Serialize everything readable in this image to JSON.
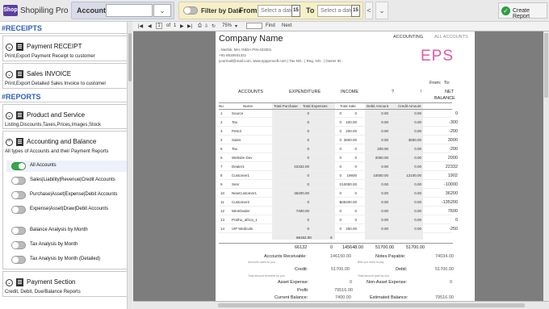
{
  "app": {
    "logo_text": "Shop",
    "title": "Shopiling Pro"
  },
  "topbar": {
    "accounts_label": "Accounts",
    "accounts_value": "",
    "dropdown_glyph": "⌄",
    "filter_label": "Filter by Date",
    "from_label": "From",
    "to_label": "To",
    "date_placeholder": "Select a date",
    "cal_num": "15",
    "create_label": "Create Report",
    "more_glyph": "⌄",
    "nav_glyph": "<"
  },
  "sidebar": {
    "receipts_header": "#RECEIPTS",
    "reports_header": "#REPORTS",
    "payment_receipt": {
      "title": "Payment RECEIPT",
      "desc": "Print,Export Payment Receipt to customer"
    },
    "sales_invoice": {
      "title": "Sales INVOICE",
      "desc": "Print,Export Detailed Sales Invoice to customer"
    },
    "product_service": {
      "title": "Product and Service",
      "desc": "Listing,Discounts,Taxes,Prices,Images,Stock"
    },
    "accounting_balance": {
      "title": "Accounting and Balance",
      "desc": "All types of Accounts and their Payment Reports"
    },
    "options": [
      {
        "label": "All Accounts",
        "on": true
      },
      {
        "label": "Sales|Liability|Revenue|Credit Accounts",
        "on": false
      },
      {
        "label": "Purchase|Asset|Expense|Debit Accounts",
        "on": false
      },
      {
        "label": "Expense|Asset|Draw|Debit Accounts",
        "on": false
      },
      {
        "label": "Balance Analysis by Month",
        "on": false
      },
      {
        "label": "Tax Analysis by Month",
        "on": false
      },
      {
        "label": "Tax Analysis by Month (Detailed)",
        "on": false
      }
    ],
    "payment_section": {
      "title": "Payment Section",
      "desc": "Credit, Debit, Due/Balance Reports"
    }
  },
  "viewer": {
    "page": "1",
    "of": "of",
    "pages": "1",
    "zoom": "75%",
    "find": "Find",
    "next": "Next"
  },
  "report": {
    "company": "Company Name",
    "heading_a": "ACCOUNTING",
    "heading_b": "ALL ACCOUNTS",
    "addr1": ", Nashik, MH, INDIA PIN-423301",
    "addr2": "+91-8530931321",
    "addr3": "yourmail@mail.com, www.eppprosoft.com | Tax NO.: | Reg. NO.: | Owner ID.:",
    "logo": "EPS",
    "from": "From:",
    "to": "To:",
    "col_accounts": "ACCOUNTS",
    "col_expenditure": "EXPENDITURE",
    "col_income": "INCOME",
    "col_q1": "?",
    "col_q2": "!",
    "col_net": "NET",
    "col_balance": "BALANCE",
    "sub": [
      "No.",
      "Name",
      "Total Purchase",
      "Total Expenses",
      "Total Sale",
      "Debit Amount",
      "Credit Amount",
      ""
    ],
    "rows": [
      [
        "1",
        "Source",
        "0",
        "0",
        "0",
        "0.00",
        "0.00",
        "0"
      ],
      [
        "2",
        "Tax",
        "0",
        "0",
        "100.00",
        "0.00",
        "0.00",
        "-300"
      ],
      [
        "3",
        "Petrol",
        "0",
        "0",
        "200.00",
        "0.00",
        "0.00",
        "-200"
      ],
      [
        "4",
        "Sales",
        "0",
        "0",
        "3600.00",
        "0.00",
        "3600.00",
        "3000"
      ],
      [
        "5",
        "Tax",
        "0",
        "0",
        "0",
        "200.00",
        "0.00",
        "-200"
      ],
      [
        "6",
        "Website Dev",
        "0",
        "0",
        "0",
        "2000.00",
        "0.00",
        "2000"
      ],
      [
        "7",
        "Dealer1",
        "22332.00",
        "0",
        "0",
        "0.00",
        "0.00",
        "22332"
      ],
      [
        "8",
        "Customer1",
        "0",
        "0",
        "19600",
        "10000.00",
        "12100.00",
        "1902"
      ],
      [
        "9",
        "Senr",
        "0",
        "0",
        "10000.00",
        "0.00",
        "0.00",
        "-10000"
      ],
      [
        "10",
        "NewCustomer1",
        "36200.00",
        "0",
        "0",
        "0.00",
        "0.00",
        "36200"
      ],
      [
        "11",
        "Customer2",
        "0",
        "0",
        "135200.00",
        "0.00",
        "0.00",
        "-135200"
      ],
      [
        "12",
        "WireDealer",
        "7400.00",
        "0",
        "0",
        "0.00",
        "0.00",
        "7600"
      ],
      [
        "13",
        "Pratho_africa_1",
        "0",
        "0",
        "0",
        "0.00",
        "0.00",
        "0"
      ],
      [
        "14",
        "VIP Medicals",
        "0",
        "0",
        "250.00",
        "0.00",
        "0.00",
        "-250"
      ]
    ],
    "subtotal_purchase": "66152.00",
    "subtotal_expense": "0",
    "totals": [
      "66132",
      "0",
      "145648.00",
      "51700.00",
      "51700.00"
    ],
    "summary": {
      "acc_rec_label": "Accounts Receivable:",
      "acc_rec_val": "146150.00",
      "acc_rec_note": "Amounts owed to you",
      "notes_pay_label": "Notes Payable:",
      "notes_pay_val": "74034.00",
      "notes_pay_note": "Bills you need to pay",
      "credit_label": "Credit:",
      "credit_val": "51700.00",
      "credit_note": "Total amount received by you",
      "debit_label": "Debit:",
      "debit_val": "51700.00",
      "debit_note": "Total amount paid by you",
      "asset_label": "Asset Expense:",
      "asset_val": "0",
      "nonasset_label": "Non-Asset Expense:",
      "nonasset_val": "0",
      "profit_label": "Profit:",
      "profit_val": "79516.00",
      "curbal_label": "Current Balance:",
      "curbal_val": "7400.00",
      "estbal_label": "Estimated Balance:",
      "estbal_val": "79516.00"
    }
  }
}
